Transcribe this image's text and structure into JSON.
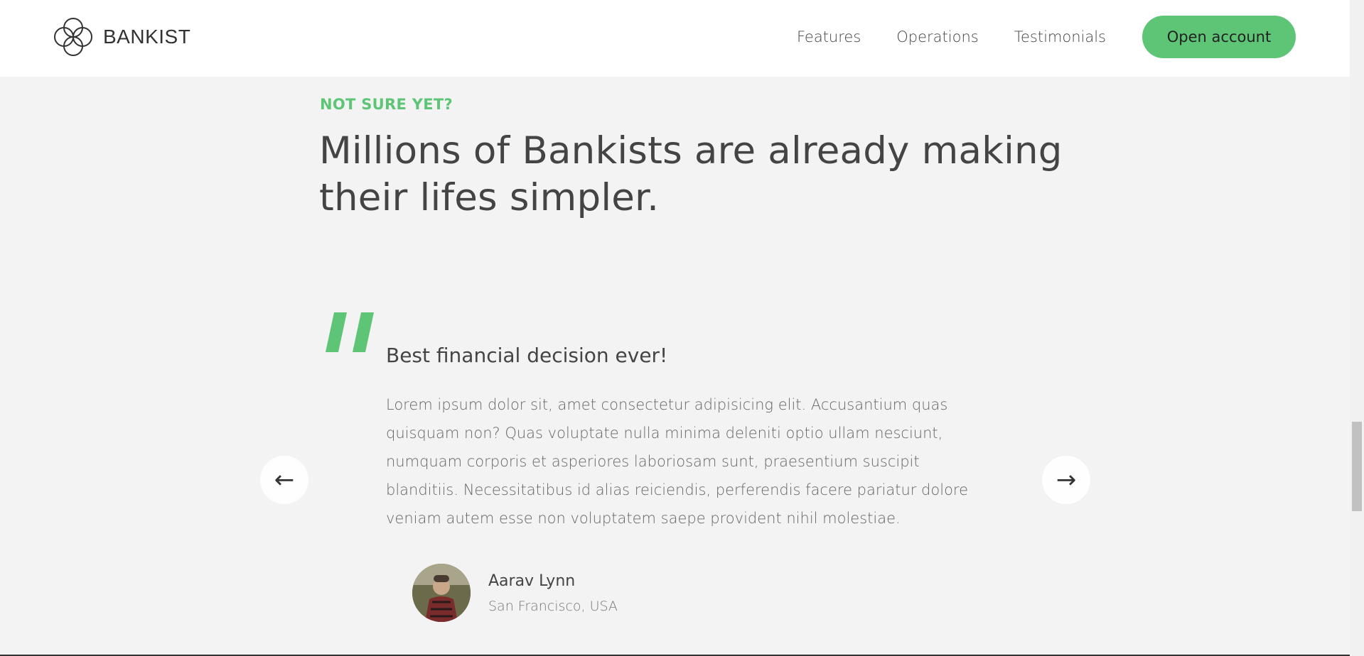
{
  "nav": {
    "logo_text": "BANKIST",
    "links": [
      "Features",
      "Operations",
      "Testimonials"
    ],
    "cta_label": "Open account"
  },
  "section": {
    "subheading": "NOT SURE YET?",
    "heading": "Millions of Bankists are already making their lifes simpler."
  },
  "testimonial": {
    "title": "Best financial decision ever!",
    "text": "Lorem ipsum dolor sit, amet consectetur adipisicing elit. Accusantium quas quisquam non? Quas voluptate nulla minima deleniti optio ullam nesciunt, numquam corporis et asperiores laboriosam sunt, praesentium suscipit blanditiis. Necessitatibus id alias reiciendis, perferendis facere pariatur dolore veniam autem esse non voluptatem saepe provident nihil molestiae.",
    "author_name": "Aarav Lynn",
    "author_location": "San Francisco, USA"
  },
  "slider": {
    "prev_label": "←",
    "next_label": "→"
  },
  "colors": {
    "accent": "#5ec576",
    "background": "#f3f3f3",
    "text": "#444444"
  }
}
